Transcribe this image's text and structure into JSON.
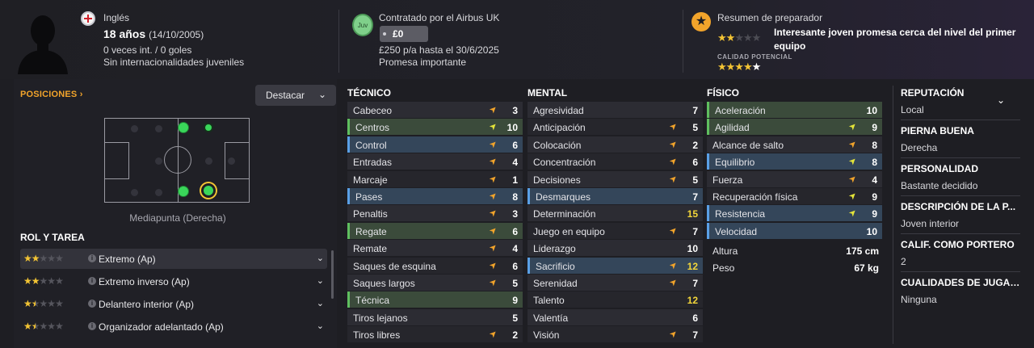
{
  "player": {
    "nationality": "Inglés",
    "age": "18 años",
    "dob": "(14/10/2005)",
    "caps": "0 veces int. / 0 goles",
    "youth_caps": "Sin internacionalidades juveniles"
  },
  "contract": {
    "club_badge": "Juv",
    "signed_by": "Contratado por el Airbus UK",
    "value": "£0",
    "wage": "£250 p/a hasta el 30/6/2025",
    "promise": "Promesa importante"
  },
  "coach": {
    "title": "Resumen de preparador",
    "summary": "Interesante joven promesa cerca del nivel del primer equipo",
    "potential_label": "CALIDAD POTENCIAL",
    "current_stars": 2,
    "potential_stars": 4.5
  },
  "positions": {
    "heading": "POSICIONES",
    "highlight_label": "Destacar",
    "caption": "Mediapunta (Derecha)"
  },
  "roles": {
    "heading": "ROL Y TAREA",
    "items": [
      {
        "name": "Extremo (Ap)",
        "stars": 2
      },
      {
        "name": "Extremo inverso (Ap)",
        "stars": 2
      },
      {
        "name": "Delantero interior (Ap)",
        "stars": 1.5
      },
      {
        "name": "Organizador adelantado (Ap)",
        "stars": 1.5
      }
    ]
  },
  "technical": {
    "heading": "TÉCNICO",
    "rows": [
      {
        "name": "Cabeceo",
        "value": "3",
        "style": "alt",
        "arrow": "up"
      },
      {
        "name": "Centros",
        "value": "10",
        "style": "green",
        "arrow": "y"
      },
      {
        "name": "Control",
        "value": "6",
        "style": "blue",
        "arrow": "up"
      },
      {
        "name": "Entradas",
        "value": "4",
        "style": "alt",
        "arrow": "up"
      },
      {
        "name": "Marcaje",
        "value": "1",
        "style": "",
        "arrow": "up"
      },
      {
        "name": "Pases",
        "value": "8",
        "style": "blue",
        "arrow": "up"
      },
      {
        "name": "Penaltis",
        "value": "3",
        "style": "alt",
        "arrow": "up"
      },
      {
        "name": "Regate",
        "value": "6",
        "style": "green",
        "arrow": "up"
      },
      {
        "name": "Remate",
        "value": "4",
        "style": "alt",
        "arrow": "up"
      },
      {
        "name": "Saques de esquina",
        "value": "6",
        "style": "",
        "arrow": "up"
      },
      {
        "name": "Saques largos",
        "value": "5",
        "style": "alt",
        "arrow": "up"
      },
      {
        "name": "Técnica",
        "value": "9",
        "style": "green",
        "arrow": ""
      },
      {
        "name": "Tiros lejanos",
        "value": "5",
        "style": "alt",
        "arrow": ""
      },
      {
        "name": "Tiros libres",
        "value": "2",
        "style": "",
        "arrow": "up"
      }
    ]
  },
  "mental": {
    "heading": "MENTAL",
    "rows": [
      {
        "name": "Agresividad",
        "value": "7",
        "style": "alt",
        "arrow": ""
      },
      {
        "name": "Anticipación",
        "value": "5",
        "style": "",
        "arrow": "up"
      },
      {
        "name": "Colocación",
        "value": "2",
        "style": "alt",
        "arrow": "up"
      },
      {
        "name": "Concentración",
        "value": "6",
        "style": "",
        "arrow": "up"
      },
      {
        "name": "Decisiones",
        "value": "5",
        "style": "alt",
        "arrow": "up"
      },
      {
        "name": "Desmarques",
        "value": "7",
        "style": "blue",
        "arrow": ""
      },
      {
        "name": "Determinación",
        "value": "15",
        "style": "alt",
        "arrow": "",
        "color": "yel"
      },
      {
        "name": "Juego en equipo",
        "value": "7",
        "style": "",
        "arrow": "up"
      },
      {
        "name": "Liderazgo",
        "value": "10",
        "style": "alt",
        "arrow": ""
      },
      {
        "name": "Sacrificio",
        "value": "12",
        "style": "blue",
        "arrow": "up",
        "color": "yel"
      },
      {
        "name": "Serenidad",
        "value": "7",
        "style": "alt",
        "arrow": "up"
      },
      {
        "name": "Talento",
        "value": "12",
        "style": "",
        "arrow": "",
        "color": "yel"
      },
      {
        "name": "Valentía",
        "value": "6",
        "style": "alt",
        "arrow": ""
      },
      {
        "name": "Visión",
        "value": "7",
        "style": "",
        "arrow": "up"
      }
    ]
  },
  "physical": {
    "heading": "FÍSICO",
    "rows": [
      {
        "name": "Aceleración",
        "value": "10",
        "style": "green",
        "arrow": ""
      },
      {
        "name": "Agilidad",
        "value": "9",
        "style": "green",
        "arrow": "y"
      },
      {
        "name": "Alcance de salto",
        "value": "8",
        "style": "alt",
        "arrow": "up"
      },
      {
        "name": "Equilibrio",
        "value": "8",
        "style": "blue",
        "arrow": "y"
      },
      {
        "name": "Fuerza",
        "value": "4",
        "style": "alt",
        "arrow": "up"
      },
      {
        "name": "Recuperación física",
        "value": "9",
        "style": "",
        "arrow": "y"
      },
      {
        "name": "Resistencia",
        "value": "9",
        "style": "blue",
        "arrow": "y"
      },
      {
        "name": "Velocidad",
        "value": "10",
        "style": "blue",
        "arrow": ""
      }
    ],
    "height_label": "Altura",
    "height_value": "175 cm",
    "weight_label": "Peso",
    "weight_value": "67 kg"
  },
  "info": [
    {
      "label": "REPUTACIÓN",
      "value": "Local"
    },
    {
      "label": "PIERNA BUENA",
      "value": "Derecha"
    },
    {
      "label": "PERSONALIDAD",
      "value": "Bastante decidido"
    },
    {
      "label": "DESCRIPCIÓN DE LA P...",
      "value": "Joven interior"
    },
    {
      "label": "CALIF. COMO PORTERO",
      "value": "2"
    },
    {
      "label": "CUALIDADES DE JUGADO",
      "value": "Ninguna"
    }
  ]
}
